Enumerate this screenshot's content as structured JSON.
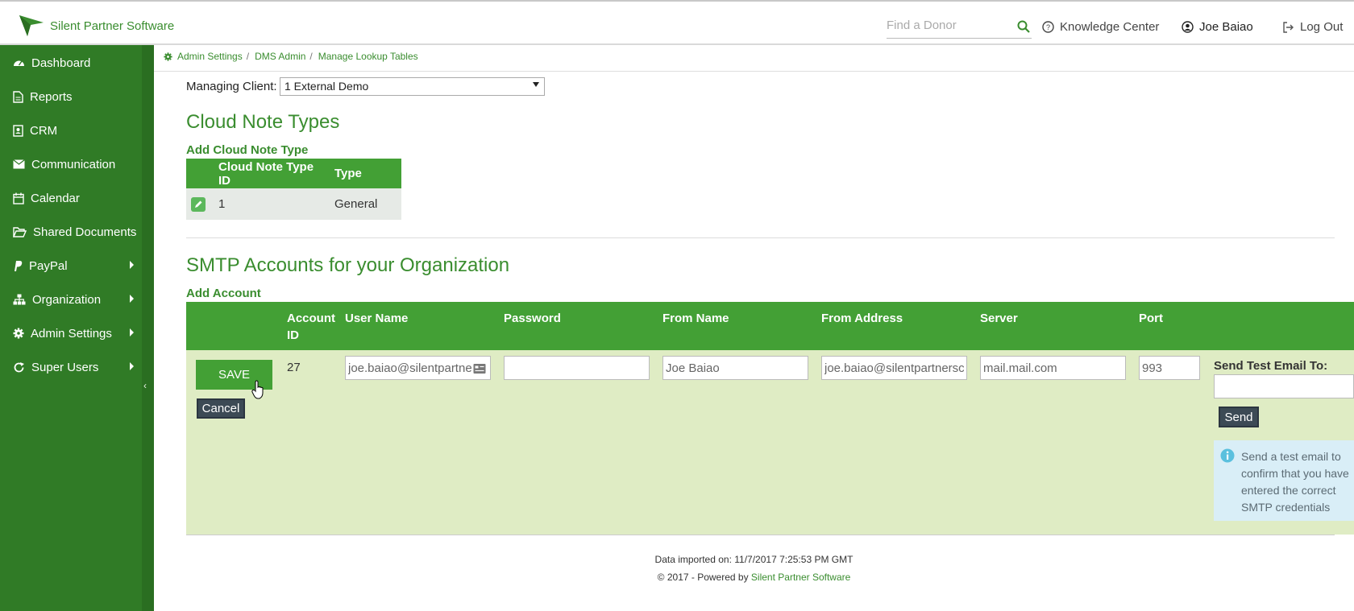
{
  "header": {
    "brand_name": "Silent Partner Software",
    "search_placeholder": "Find a Donor",
    "knowledge_center": "Knowledge Center",
    "user_name": "Joe Baiao",
    "logout": "Log Out"
  },
  "sidebar": {
    "items": [
      {
        "label": "Dashboard",
        "icon": "dashboard-icon"
      },
      {
        "label": "Reports",
        "icon": "document-icon"
      },
      {
        "label": "CRM",
        "icon": "contact-card-icon"
      },
      {
        "label": "Communication",
        "icon": "envelope-icon"
      },
      {
        "label": "Calendar",
        "icon": "calendar-icon"
      },
      {
        "label": "Shared Documents",
        "icon": "folder-open-icon"
      },
      {
        "label": "PayPal",
        "icon": "paypal-icon"
      },
      {
        "label": "Organization",
        "icon": "sitemap-icon"
      },
      {
        "label": "Admin Settings",
        "icon": "gear-icon"
      },
      {
        "label": "Super Users",
        "icon": "refresh-icon"
      }
    ]
  },
  "breadcrumb": [
    "Admin Settings",
    "DMS Admin",
    "Manage Lookup Tables"
  ],
  "managing_client": {
    "label": "Managing Client:",
    "value": "1 External Demo"
  },
  "cloud_notes": {
    "title": "Cloud Note Types",
    "add_link": "Add Cloud Note Type",
    "columns": [
      "Cloud Note Type ID",
      "Type"
    ],
    "rows": [
      {
        "id": "1",
        "type": "General"
      }
    ]
  },
  "smtp": {
    "title": "SMTP Accounts for your Organization",
    "add_link": "Add Account",
    "columns": {
      "account_id": "Account ID",
      "user_name": "User Name",
      "password": "Password",
      "from_name": "From Name",
      "from_address": "From Address",
      "server": "Server",
      "port": "Port"
    },
    "row": {
      "save": "SAVE",
      "cancel": "Cancel",
      "account_id": "27",
      "user_name": "joe.baiao@silentpartne",
      "password": "",
      "from_name": "Joe Baiao",
      "from_address": "joe.baiao@silentpartnersc",
      "server": "mail.mail.com",
      "port": "993"
    },
    "test": {
      "label": "Send Test Email To:",
      "send": "Send",
      "info": "Send a test email to confirm that you have entered the correct SMTP credentials"
    }
  },
  "footer": {
    "imported": "Data imported on: 11/7/2017 7:25:53 PM GMT",
    "powered_prefix": "© 2017 - Powered by ",
    "powered_link": "Silent Partner Software"
  },
  "colors": {
    "brand_green": "#307b26",
    "accent_green": "#43a035",
    "row_bg": "#dfecc4"
  }
}
